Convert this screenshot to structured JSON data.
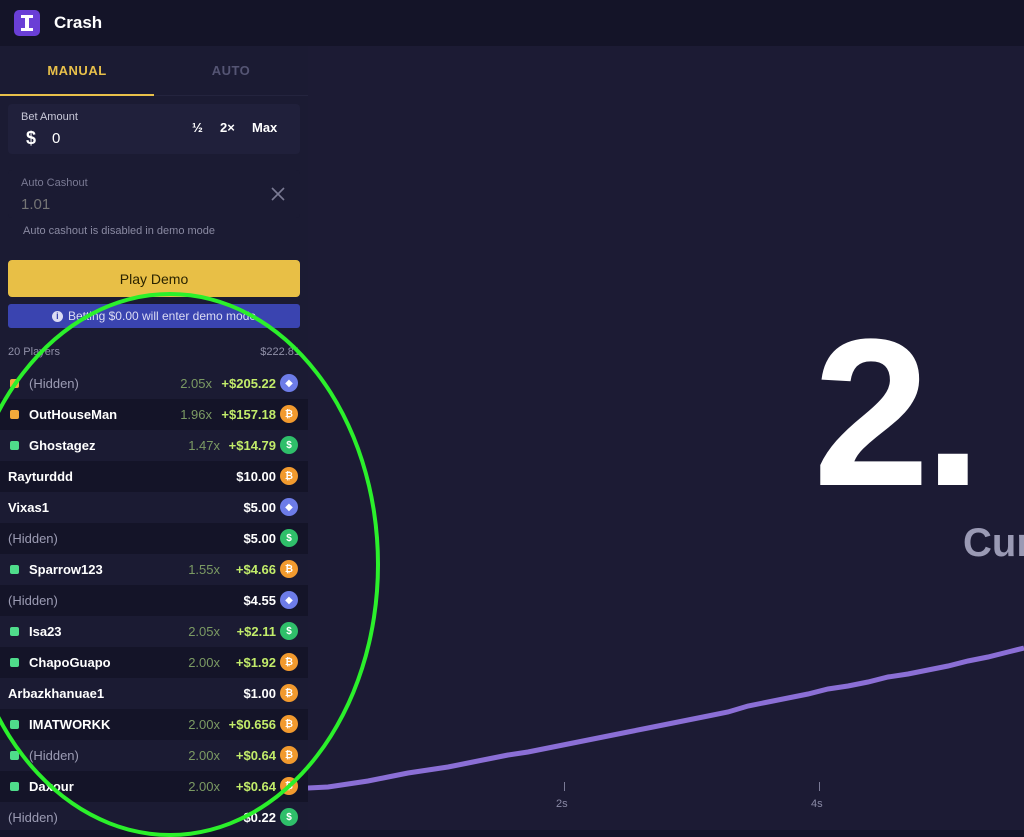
{
  "app": {
    "title": "Crash",
    "logo_icon": "tower-icon",
    "accent": "#e8bf46"
  },
  "tabs": [
    {
      "label": "MANUAL",
      "active": true
    },
    {
      "label": "AUTO",
      "active": false
    }
  ],
  "bet": {
    "label": "Bet Amount",
    "currency": "$",
    "value": "0",
    "half": "½",
    "double": "2×",
    "max": "Max"
  },
  "cashout": {
    "label": "Auto Cashout",
    "placeholder": "1.01",
    "note": "Auto cashout is disabled in demo mode"
  },
  "play_label": "Play Demo",
  "info_text": "Betting $0.00 will enter demo mode",
  "players": {
    "count_label": "20 Players",
    "total": "$222.81"
  },
  "rows": [
    {
      "name": "(Hidden)",
      "hidden": true,
      "status": "orange",
      "mult": "2.05x",
      "amount": "+$205.22",
      "profit": true,
      "coin": "eth"
    },
    {
      "name": "OutHouseMan",
      "hidden": false,
      "status": "orange",
      "mult": "1.96x",
      "amount": "+$157.18",
      "profit": true,
      "coin": "btc"
    },
    {
      "name": "Ghostagez",
      "hidden": false,
      "status": "green",
      "mult": "1.47x",
      "amount": "+$14.79",
      "profit": true,
      "coin": "cash"
    },
    {
      "name": "Rayturddd",
      "hidden": false,
      "status": "",
      "mult": "",
      "amount": "$10.00",
      "profit": false,
      "coin": "btc"
    },
    {
      "name": "Vixas1",
      "hidden": false,
      "status": "",
      "mult": "",
      "amount": "$5.00",
      "profit": false,
      "coin": "eth"
    },
    {
      "name": "(Hidden)",
      "hidden": true,
      "status": "",
      "mult": "",
      "amount": "$5.00",
      "profit": false,
      "coin": "cash"
    },
    {
      "name": "Sparrow123",
      "hidden": false,
      "status": "green",
      "mult": "1.55x",
      "amount": "+$4.66",
      "profit": true,
      "coin": "btc"
    },
    {
      "name": "(Hidden)",
      "hidden": true,
      "status": "",
      "mult": "",
      "amount": "$4.55",
      "profit": false,
      "coin": "eth"
    },
    {
      "name": "Isa23",
      "hidden": false,
      "status": "green",
      "mult": "2.05x",
      "amount": "+$2.11",
      "profit": true,
      "coin": "cash"
    },
    {
      "name": "ChapoGuapo",
      "hidden": false,
      "status": "green",
      "mult": "2.00x",
      "amount": "+$1.92",
      "profit": true,
      "coin": "btc"
    },
    {
      "name": "Arbazkhanuae1",
      "hidden": false,
      "status": "",
      "mult": "",
      "amount": "$1.00",
      "profit": false,
      "coin": "btc"
    },
    {
      "name": "IMATWORKK",
      "hidden": false,
      "status": "green",
      "mult": "2.00x",
      "amount": "+$0.656",
      "profit": true,
      "coin": "btc"
    },
    {
      "name": "(Hidden)",
      "hidden": true,
      "status": "green",
      "mult": "2.00x",
      "amount": "+$0.64",
      "profit": true,
      "coin": "btc"
    },
    {
      "name": "Daxour",
      "hidden": false,
      "status": "green",
      "mult": "2.00x",
      "amount": "+$0.64",
      "profit": true,
      "coin": "btc"
    },
    {
      "name": "(Hidden)",
      "hidden": true,
      "status": "",
      "mult": "",
      "amount": "$0.22",
      "profit": false,
      "coin": "cash"
    }
  ],
  "game": {
    "multiplier": "2.",
    "status_label": "Cur",
    "line_color": "#8b6fd6"
  },
  "timeline": {
    "ticks": [
      "2s",
      "4s"
    ]
  }
}
